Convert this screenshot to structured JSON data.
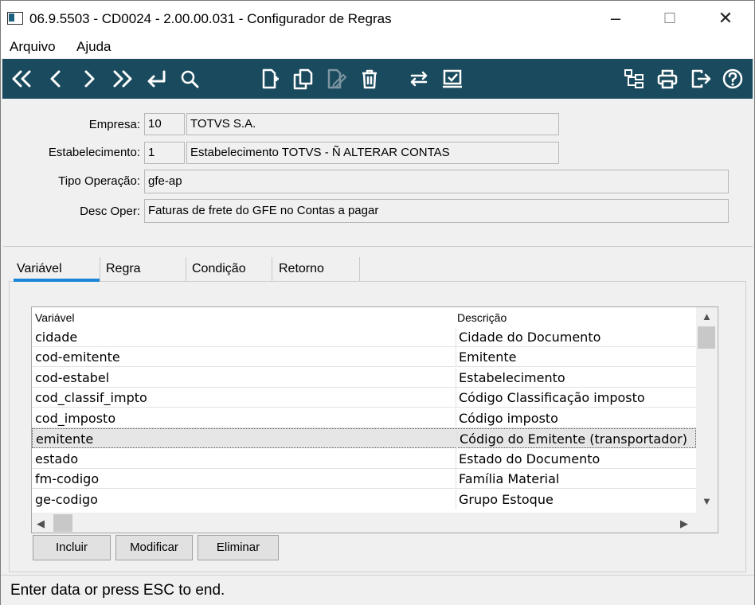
{
  "window": {
    "title": "06.9.5503 - CD0024 - 2.00.00.031 - Configurador de Regras",
    "min_label": "–",
    "max_label": "☐",
    "close_label": "✕"
  },
  "menu": {
    "items": [
      "Arquivo",
      "Ajuda"
    ]
  },
  "toolbar": {
    "icons": [
      "first-icon",
      "prev-icon",
      "next-icon",
      "last-icon",
      "goto-icon",
      "search-icon",
      "new-icon",
      "copy-icon",
      "edit-icon",
      "delete-icon",
      "swap-icon",
      "confirm-icon",
      "structure-icon",
      "print-icon",
      "exit-icon",
      "help-icon"
    ],
    "bg_color": "#1a4a5e"
  },
  "form": {
    "empresa_label": "Empresa:",
    "empresa_code": "10",
    "empresa_name": "TOTVS S.A.",
    "estab_label": "Estabelecimento:",
    "estab_code": "1",
    "estab_name": "Estabelecimento TOTVS - Ñ ALTERAR CONTAS",
    "tipo_label": "Tipo Operação:",
    "tipo_value": "gfe-ap",
    "desc_label": "Desc Oper:",
    "desc_value": "Faturas de frete do GFE no Contas a pagar"
  },
  "tabs": [
    "Variável",
    "Regra",
    "Condição",
    "Retorno"
  ],
  "active_tab": 0,
  "grid": {
    "headers": [
      "Variável",
      "Descrição"
    ],
    "rows": [
      [
        "cidade",
        "Cidade do Documento"
      ],
      [
        "cod-emitente",
        "Emitente"
      ],
      [
        "cod-estabel",
        "Estabelecimento"
      ],
      [
        "cod_classif_impto",
        "Código Classificação imposto"
      ],
      [
        "cod_imposto",
        "Código imposto"
      ],
      [
        "emitente",
        "Código do Emitente (transportador)"
      ],
      [
        "estado",
        "Estado do Documento"
      ],
      [
        "fm-codigo",
        "Família Material"
      ],
      [
        "ge-codigo",
        "Grupo Estoque"
      ]
    ],
    "selected_row": 5
  },
  "buttons": {
    "incluir": "Incluir",
    "modificar": "Modificar",
    "eliminar": "Eliminar"
  },
  "status": {
    "text": "Enter data or press ESC to end."
  },
  "colors": {
    "tab_active": "#1c86d6",
    "selected_row": "#e6e6e6"
  }
}
